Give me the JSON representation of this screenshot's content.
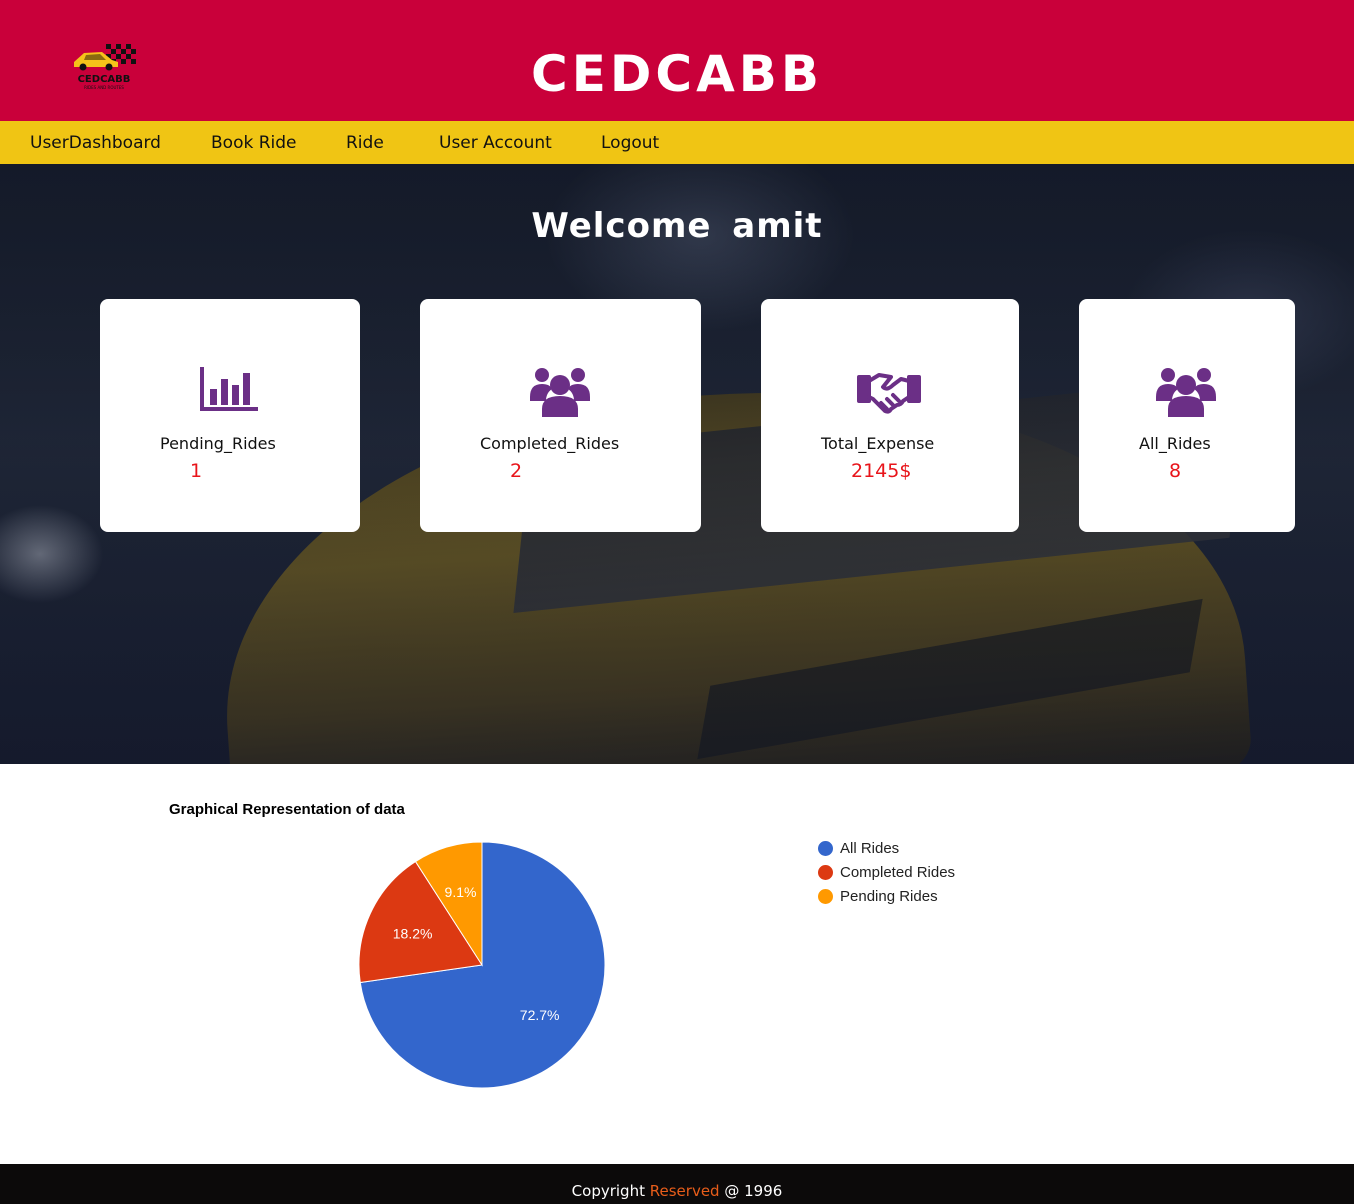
{
  "header": {
    "logo_text": "CEDCABB",
    "logo_tagline": "RIDES AND ROUTES",
    "title": "CEDCABB",
    "colors": {
      "header_bg": "#c9003a",
      "nav_bg": "#f0c514"
    }
  },
  "nav": {
    "items": [
      {
        "label": "UserDashboard"
      },
      {
        "label": "Book Ride"
      },
      {
        "label": "Ride"
      },
      {
        "label": "User Account"
      },
      {
        "label": "Logout"
      }
    ]
  },
  "hero": {
    "welcome_prefix": "Welcome",
    "username": "amit"
  },
  "cards": [
    {
      "icon": "bar-chart-icon",
      "label": "Pending_Rides",
      "value": "1"
    },
    {
      "icon": "users-icon",
      "label": "Completed_Rides",
      "value": "2"
    },
    {
      "icon": "handshake-icon",
      "label": "Total_Expense",
      "value": "2145$"
    },
    {
      "icon": "users-icon",
      "label": "All_Rides",
      "value": "8"
    }
  ],
  "chart_section": {
    "title": "Graphical Representation of data"
  },
  "chart_data": {
    "type": "pie",
    "title": "Graphical Representation of data",
    "categories": [
      "All Rides",
      "Completed Rides",
      "Pending Rides"
    ],
    "values": [
      8,
      2,
      1
    ],
    "percent_labels": [
      "72.7%",
      "18.2%",
      "9.1%"
    ],
    "colors": [
      "#3366cc",
      "#dc3912",
      "#ff9900"
    ],
    "legend_position": "right"
  },
  "footer": {
    "prefix": "Copyright",
    "accent": "Reserved",
    "suffix": "@ 1996",
    "accent_color": "#e85d1a"
  }
}
